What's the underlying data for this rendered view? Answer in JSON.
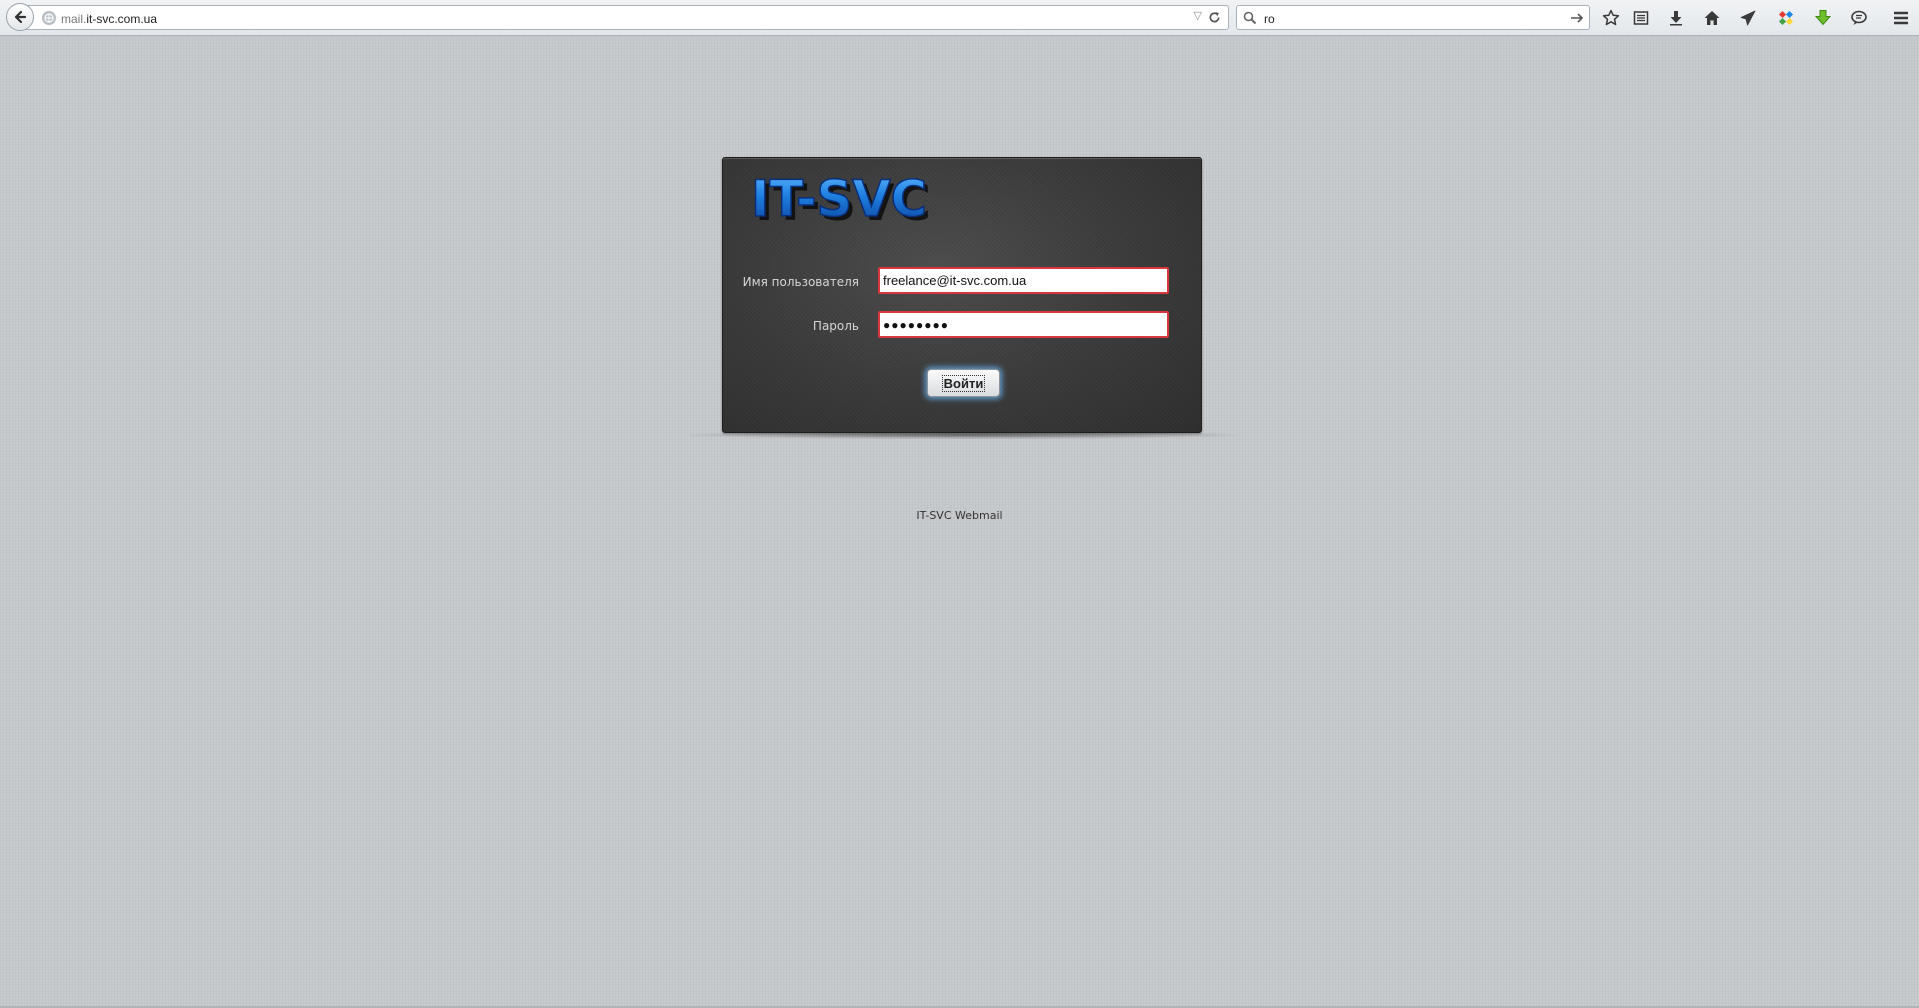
{
  "browser": {
    "url": {
      "prefix": "mail.",
      "domain": "it-svc.com.ua"
    },
    "search": {
      "value": "ro"
    },
    "toolbar_icons": [
      "bookmark-star-icon",
      "reading-list-icon",
      "downloads-icon",
      "home-icon",
      "send-icon",
      "addon-icon",
      "green-download-icon",
      "chat-icon",
      "menu-icon"
    ]
  },
  "login": {
    "logo_text": "IT-SVC",
    "username_label": "Имя пользователя",
    "username_value": "freelance@it-svc.com.ua",
    "password_label": "Пароль",
    "password_value": "●●●●●●●●",
    "submit_label": "Войти"
  },
  "footer": {
    "text": "IT-SVC Webmail"
  },
  "colors": {
    "background": "#c6c9cc",
    "box": "#3a3a3a",
    "input_border": "#d9363e",
    "logo_blue": "#1e7fe0"
  }
}
